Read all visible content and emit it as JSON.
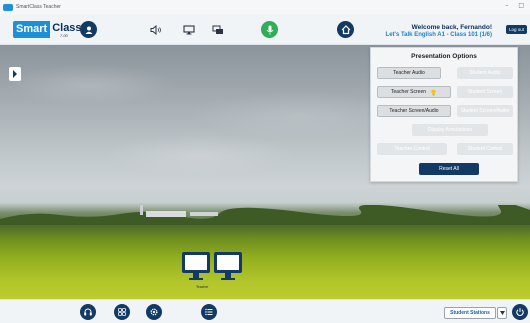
{
  "window": {
    "title": "SmartClass Teacher"
  },
  "header": {
    "logo_smart": "Smart",
    "logo_class": "Class",
    "logo_version": "7.00",
    "welcome": "Welcome back, Fernando!",
    "class_info": "Let's Talk English A1 - Class 101 (1/6)",
    "logout_label": "Log out"
  },
  "panel": {
    "title": "Presentation Options",
    "buttons": {
      "teacher_audio": "Teacher Audio",
      "student_audio": "Student Audio",
      "teacher_screen": "Teacher Screen",
      "student_screen": "Student Screen",
      "teacher_screen_audio": "Teacher Screen/Audio",
      "student_screen_audio": "Student Screen/Audio",
      "display_annotations": "Display Annotations",
      "teacher_control": "Teacher Control",
      "student_control": "Student Control",
      "reset_all": "Reset All"
    }
  },
  "monitors_label": "Teacher",
  "bottombar": {
    "stations_label": "Student Stations"
  },
  "colors": {
    "navy": "#123a64",
    "accent_blue": "#1e90d8",
    "mic_green": "#2fae5a"
  }
}
